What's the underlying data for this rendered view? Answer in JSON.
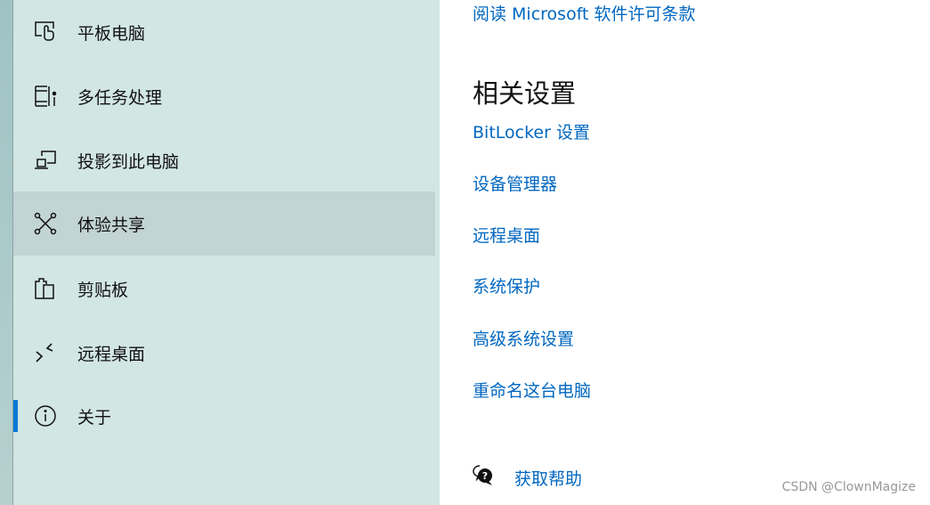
{
  "sidebar": {
    "items": [
      {
        "label": "平板电脑",
        "icon": "tablet-icon"
      },
      {
        "label": "多任务处理",
        "icon": "multitasking-icon"
      },
      {
        "label": "投影到此电脑",
        "icon": "project-icon"
      },
      {
        "label": "体验共享",
        "icon": "shared-experiences-icon",
        "hovered": true
      },
      {
        "label": "剪贴板",
        "icon": "clipboard-icon"
      },
      {
        "label": "远程桌面",
        "icon": "remote-desktop-icon"
      },
      {
        "label": "关于",
        "icon": "info-icon",
        "selected": true
      }
    ]
  },
  "main": {
    "license_link": "阅读 Microsoft 软件许可条款",
    "related_title": "相关设置",
    "related_links": [
      "BitLocker 设置",
      "设备管理器",
      "远程桌面",
      "系统保护",
      "高级系统设置",
      "重命名这台电脑"
    ],
    "help_label": "获取帮助"
  },
  "watermark": "CSDN @ClownMagize",
  "colors": {
    "accent": "#0078d4",
    "link": "#0067c0",
    "sidebar_bg": "#d2e6e3"
  }
}
